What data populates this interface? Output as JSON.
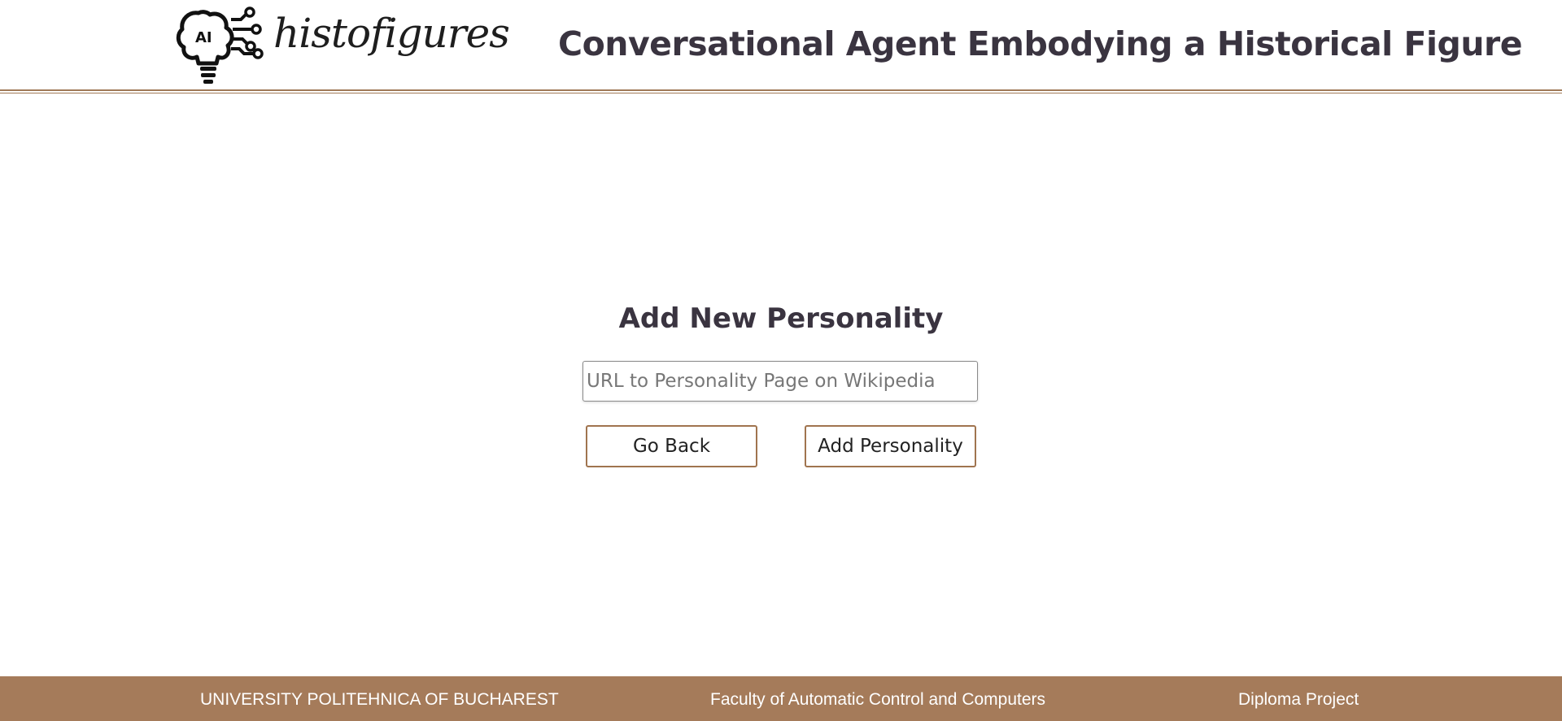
{
  "header": {
    "logo_badge": "AI",
    "logo_text": "histofigures",
    "title": "Conversational Agent Embodying a Historical Figure"
  },
  "form": {
    "title": "Add New Personality",
    "url_placeholder": "URL to Personality Page on Wikipedia",
    "url_value": "",
    "back_label": "Go Back",
    "add_label": "Add Personality"
  },
  "footer": {
    "university": "UNIVERSITY POLITEHNICA OF BUCHAREST",
    "faculty": "Faculty of Automatic Control and Computers",
    "project": "Diploma Project"
  },
  "colors": {
    "accent": "#a57b5a",
    "title_text": "#3a3440",
    "footer_text": "#ffffff"
  },
  "icons": {
    "logo": "ai-lightbulb-icon"
  }
}
